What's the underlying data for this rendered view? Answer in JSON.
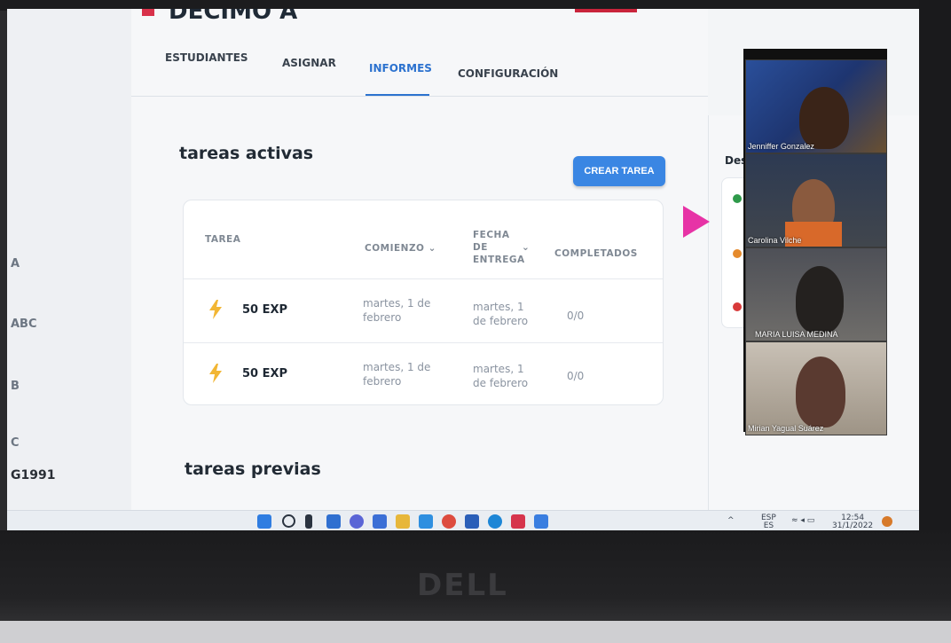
{
  "header": {
    "class_title": "DECIMO A"
  },
  "tabs": [
    {
      "label": "ESTUDIANTES"
    },
    {
      "label": "ASIGNAR"
    },
    {
      "label": "INFORMES"
    },
    {
      "label": "CONFIGURACIÓN"
    }
  ],
  "left_panel": [
    "A",
    "ABC",
    "B",
    "C",
    "G1991"
  ],
  "active_tasks": {
    "title": "tareas activas",
    "create_button": "CREAR TAREA",
    "columns": {
      "task": "TAREA",
      "start": "COMIENZO",
      "due_1": "FECHA",
      "due_2": "DE",
      "due_3": "ENTREGA",
      "completed": "COMPLETADOS"
    },
    "rows": [
      {
        "task": "50 EXP",
        "start": "martes, 1 de febrero",
        "due": "martes, 1 de febrero",
        "completed": "0/0"
      },
      {
        "task": "50 EXP",
        "start": "martes, 1 de febrero",
        "due": "martes, 1 de febrero",
        "completed": "0/0"
      }
    ]
  },
  "previous_tasks": {
    "title": "tareas previas"
  },
  "right_panel": {
    "label": "Dese"
  },
  "video_call": {
    "participants": [
      "Jenniffer Gonzalez",
      "Carolina Vilche",
      "MARIA LUISA MEDINA",
      "Mirian Yagual Suárez"
    ]
  },
  "taskbar": {
    "lang_1": "ESP",
    "lang_2": "ES",
    "time": "12:54",
    "date": "31/1/2022"
  },
  "device": {
    "brand": "DELL"
  },
  "colors": {
    "accent": "#2c72cf",
    "button": "#3a86e3",
    "pointer": "#e733a6"
  }
}
